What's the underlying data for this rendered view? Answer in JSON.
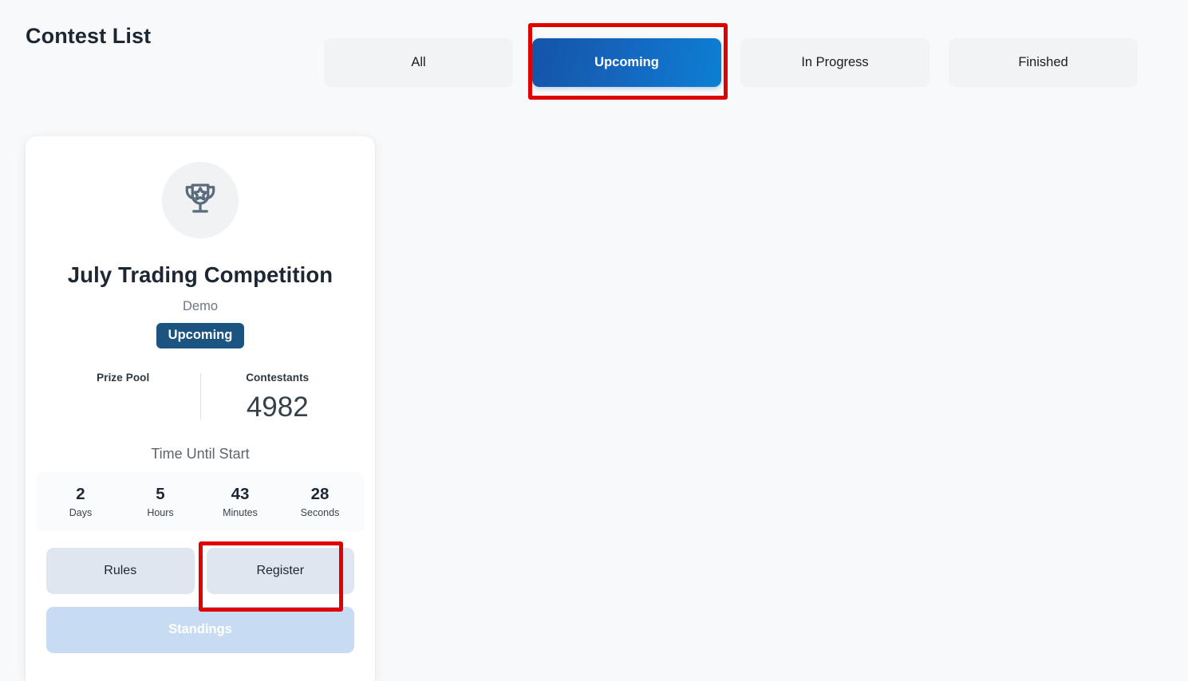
{
  "header": {
    "title": "Contest List"
  },
  "tabs": [
    {
      "label": "All",
      "active": false
    },
    {
      "label": "Upcoming",
      "active": true
    },
    {
      "label": "In Progress",
      "active": false
    },
    {
      "label": "Finished",
      "active": false
    }
  ],
  "contest": {
    "icon": "trophy-star-icon",
    "name": "July Trading Competition",
    "account_type": "Demo",
    "status": "Upcoming",
    "stats": {
      "prize_pool_label": "Prize Pool",
      "prize_pool_value": "",
      "contestants_label": "Contestants",
      "contestants_value": "4982"
    },
    "countdown": {
      "title": "Time Until Start",
      "cells": [
        {
          "value": "2",
          "unit": "Days"
        },
        {
          "value": "5",
          "unit": "Hours"
        },
        {
          "value": "43",
          "unit": "Minutes"
        },
        {
          "value": "28",
          "unit": "Seconds"
        }
      ]
    },
    "actions": {
      "rules_label": "Rules",
      "register_label": "Register",
      "standings_label": "Standings"
    }
  },
  "colors": {
    "page_background": "#f8f9fa",
    "tab_inactive_background": "#f1f3f4",
    "tab_active_gradient_start": "#1454a8",
    "tab_active_gradient_end": "#0c7fd3",
    "status_badge_background": "#1b5480",
    "action_button_background": "#dfe6ef",
    "standings_button_background": "#c7dcf3",
    "highlight_outline": "#e00000",
    "trophy_circle_background": "#f1f2f3",
    "trophy_stroke": "#5a6b7d"
  }
}
